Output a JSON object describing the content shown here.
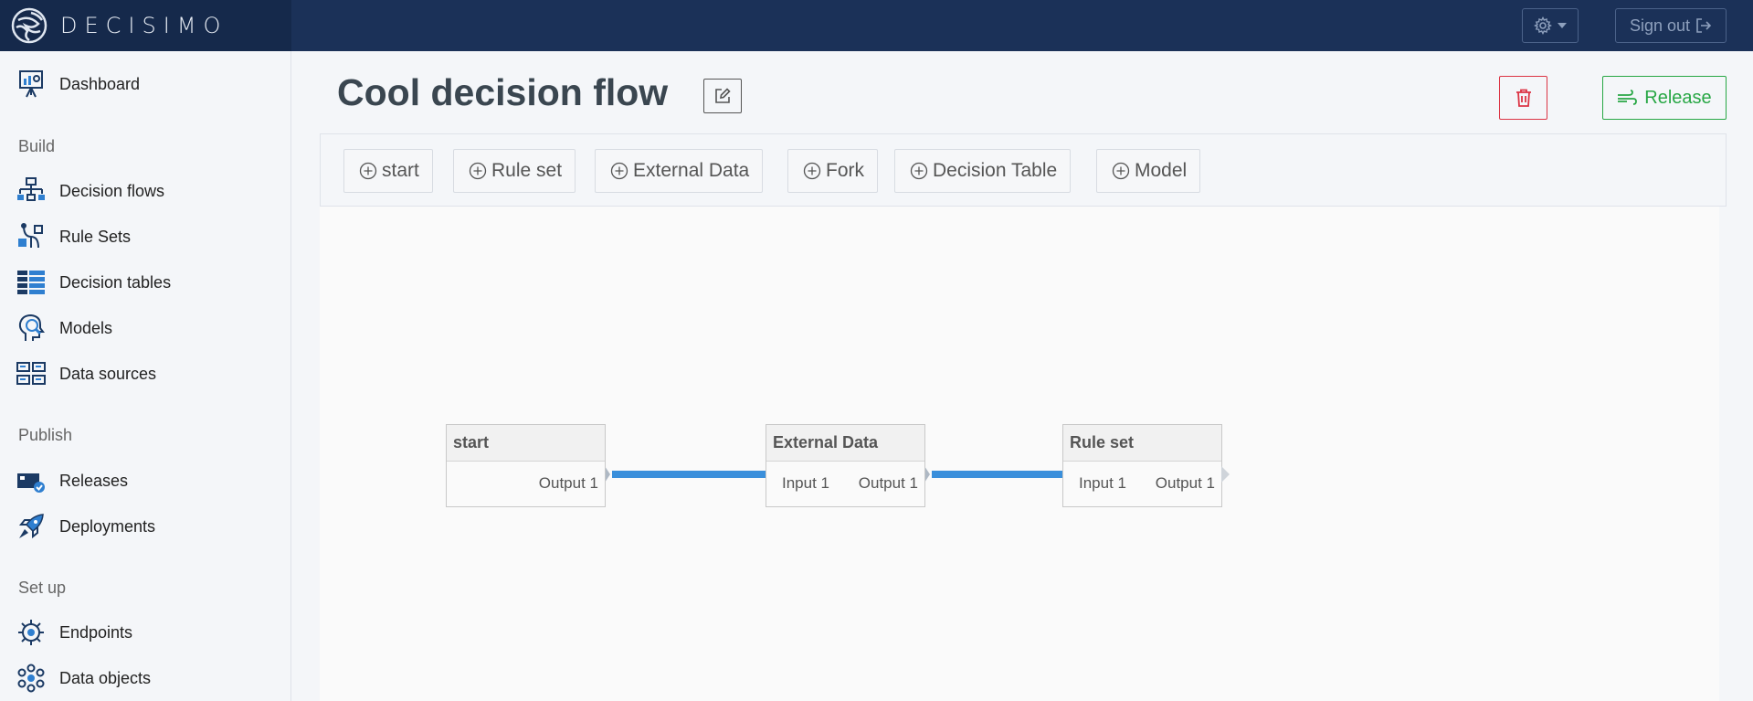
{
  "brand": {
    "name": "DECISIMO",
    "colors": {
      "topbar": "#1b3158",
      "brand_bg": "#15294b",
      "connector": "#3a8fdb",
      "danger": "#dc3545",
      "success": "#28a745"
    }
  },
  "header": {
    "settings_icon": "gear-icon",
    "signout_label": "Sign out"
  },
  "sidebar": {
    "top_item": {
      "label": "Dashboard",
      "icon": "dashboard-icon"
    },
    "sections": [
      {
        "title": "Build",
        "items": [
          {
            "label": "Decision flows",
            "icon": "flowchart-icon"
          },
          {
            "label": "Rule Sets",
            "icon": "ruleset-icon"
          },
          {
            "label": "Decision tables",
            "icon": "table-icon"
          },
          {
            "label": "Models",
            "icon": "model-icon"
          },
          {
            "label": "Data sources",
            "icon": "datasource-icon"
          }
        ]
      },
      {
        "title": "Publish",
        "items": [
          {
            "label": "Releases",
            "icon": "release-icon"
          },
          {
            "label": "Deployments",
            "icon": "rocket-icon"
          }
        ]
      },
      {
        "title": "Set up",
        "items": [
          {
            "label": "Endpoints",
            "icon": "endpoint-icon"
          },
          {
            "label": "Data objects",
            "icon": "data-objects-icon"
          }
        ]
      }
    ]
  },
  "page": {
    "title": "Cool decision flow",
    "release_label": "Release"
  },
  "toolbar": {
    "buttons": [
      "start",
      "Rule set",
      "External Data",
      "Fork",
      "Decision Table",
      "Model"
    ]
  },
  "flow": {
    "nodes": [
      {
        "title": "start",
        "input": "",
        "output": "Output 1"
      },
      {
        "title": "External Data",
        "input": "Input 1",
        "output": "Output 1"
      },
      {
        "title": "Rule set",
        "input": "Input 1",
        "output": "Output 1"
      }
    ]
  }
}
